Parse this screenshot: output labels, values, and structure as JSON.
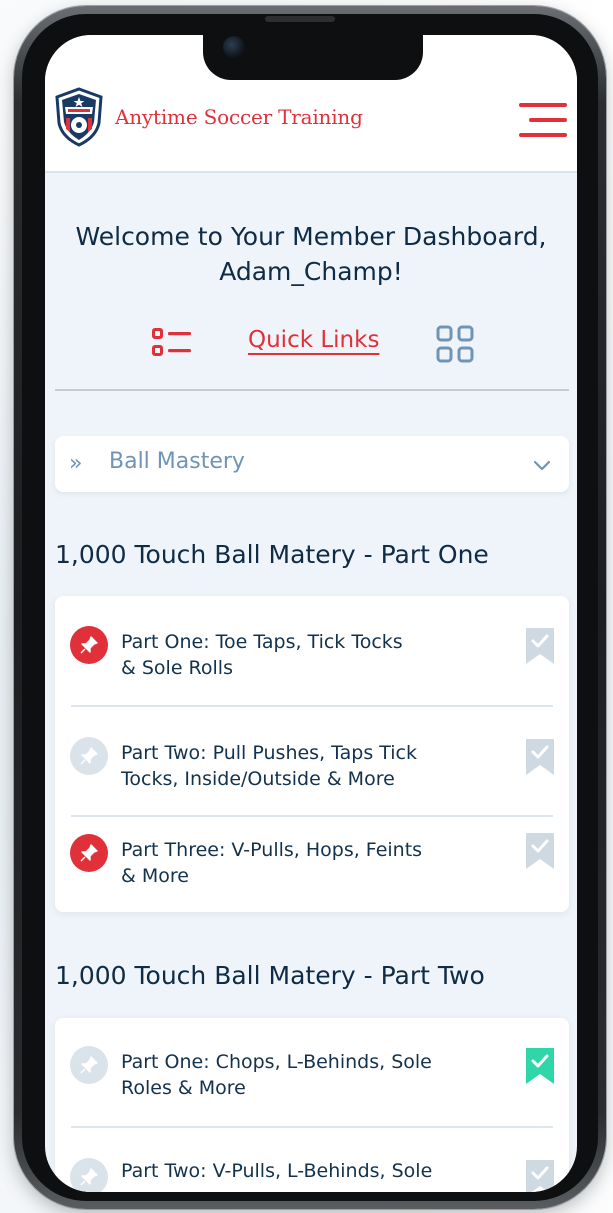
{
  "app": {
    "brand": "Anytime Soccer Training",
    "accent_color": "#e0303a",
    "navy_color": "#0f2b45"
  },
  "header": {
    "logo_icon": "soccer-shield-logo",
    "menu_icon": "hamburger-menu-icon"
  },
  "welcome": {
    "line1": "Welcome to Your Member Dashboard,",
    "line2": "Adam_Champ!"
  },
  "view_toggle": {
    "list_icon": "list-view-icon",
    "quick_links_label": "Quick Links",
    "grid_icon": "grid-view-icon"
  },
  "category_select": {
    "selected": "Ball Mastery"
  },
  "sections": [
    {
      "title": "1,000 Touch Ball Matery - Part One",
      "items": [
        {
          "line1": "Part One: Toe Taps, Tick Tocks",
          "line2": "& Sole Rolls",
          "pinned": true,
          "completed": false
        },
        {
          "line1": "Part Two: Pull Pushes, Taps Tick",
          "line2": "Tocks, Inside/Outside & More",
          "pinned": false,
          "completed": false
        },
        {
          "line1": "Part Three: V-Pulls, Hops, Feints",
          "line2": "& More",
          "pinned": true,
          "completed": false
        }
      ]
    },
    {
      "title": "1,000 Touch Ball Matery - Part Two",
      "items": [
        {
          "line1": "Part One: Chops, L-Behinds, Sole",
          "line2": "Roles & More",
          "pinned": false,
          "completed": true
        },
        {
          "line1": "Part Two: V-Pulls, L-Behinds, Sole",
          "line2": "",
          "pinned": false,
          "completed": false
        }
      ]
    }
  ],
  "status_colors": {
    "pinned": "#e0303a",
    "unpinned": "#dbe3ea",
    "completed": "#2fd6a8",
    "incomplete": "#cfd9e2"
  }
}
